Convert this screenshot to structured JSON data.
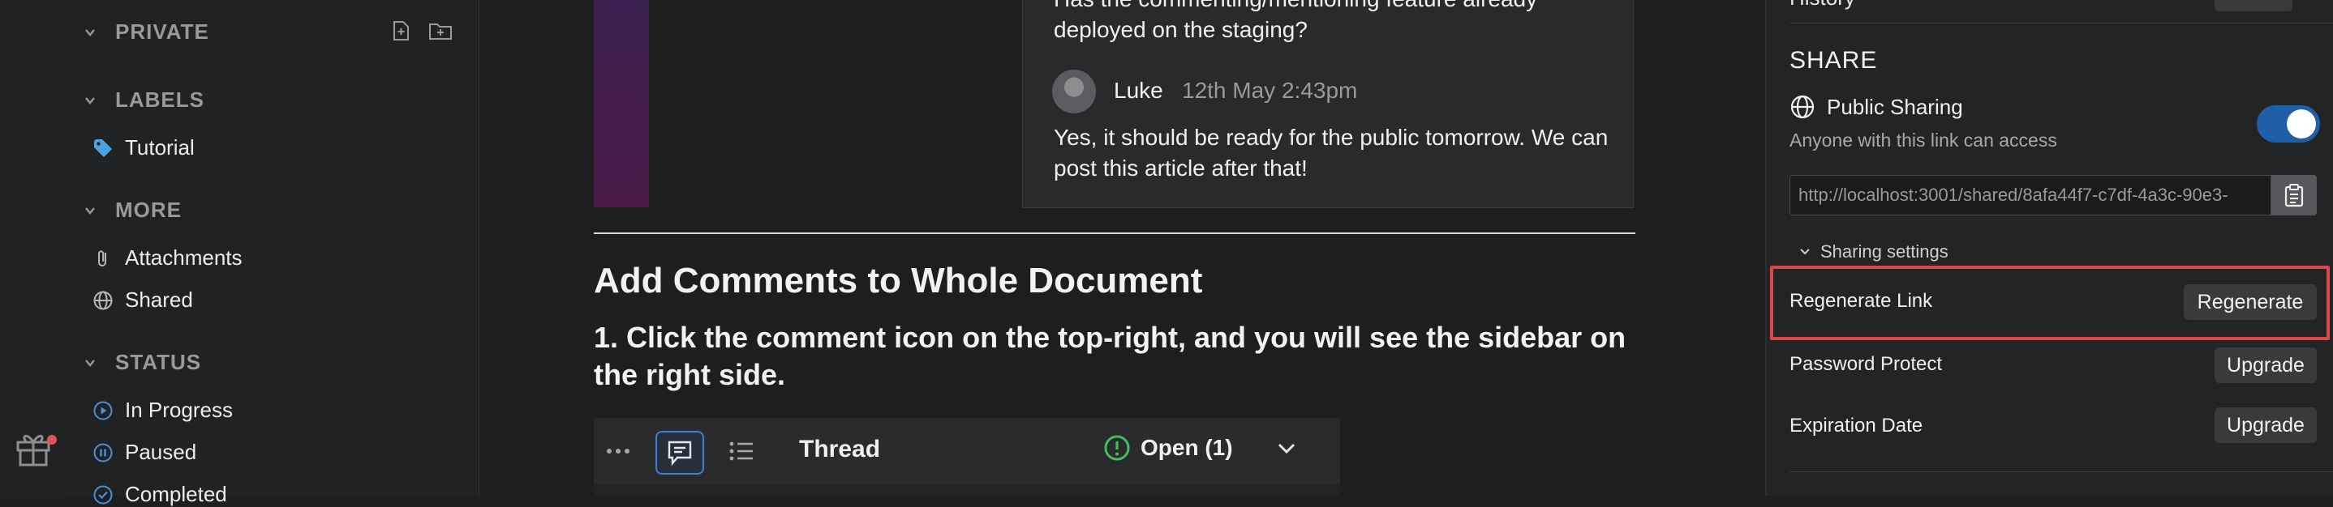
{
  "sidebar": {
    "sections": {
      "private": "PRIVATE",
      "labels": "LABELS",
      "more": "MORE",
      "status": "STATUS"
    },
    "labels_items": [
      "Tutorial"
    ],
    "more_items": [
      "Attachments",
      "Shared"
    ],
    "status_items": [
      "In Progress",
      "Paused",
      "Completed"
    ]
  },
  "document": {
    "comment_question": "Has the commenting/mentioning feature already deployed on the staging?",
    "reply_author": "Luke",
    "reply_time": "12th May 2:43pm",
    "reply_text": "Yes, it should be ready for the public tomorrow. We can post this article after that!",
    "heading": "Add Comments to Whole Document",
    "step1": "1. Click the comment icon on the top-right, and you will see the sidebar on the right side.",
    "thread": {
      "title": "Thread",
      "status": "Open (1)"
    }
  },
  "share_panel": {
    "top_label": "History",
    "title": "SHARE",
    "public_sharing": "Public Sharing",
    "public_sharing_sub": "Anyone with this link can access",
    "public_sharing_enabled": true,
    "link": "http://localhost:3001/shared/8afa44f7-c7df-4a3c-90e3-",
    "settings_label": "Sharing settings",
    "rows": {
      "regenerate_label": "Regenerate Link",
      "regenerate_btn": "Regenerate",
      "password_label": "Password Protect",
      "password_btn": "Upgrade",
      "expiration_label": "Expiration Date",
      "expiration_btn": "Upgrade"
    }
  },
  "colors": {
    "accent": "#1f5fa8",
    "highlight": "#e0454a",
    "label_tag": "#4aa3e0",
    "open_status": "#3fbf5a"
  },
  "icons": {
    "gift": "gift-icon",
    "labels": "tag-icon",
    "attachments": "paperclip-icon",
    "shared": "globe-icon",
    "in_progress": "play-circle-icon",
    "paused": "pause-circle-icon",
    "completed": "check-circle-icon"
  }
}
